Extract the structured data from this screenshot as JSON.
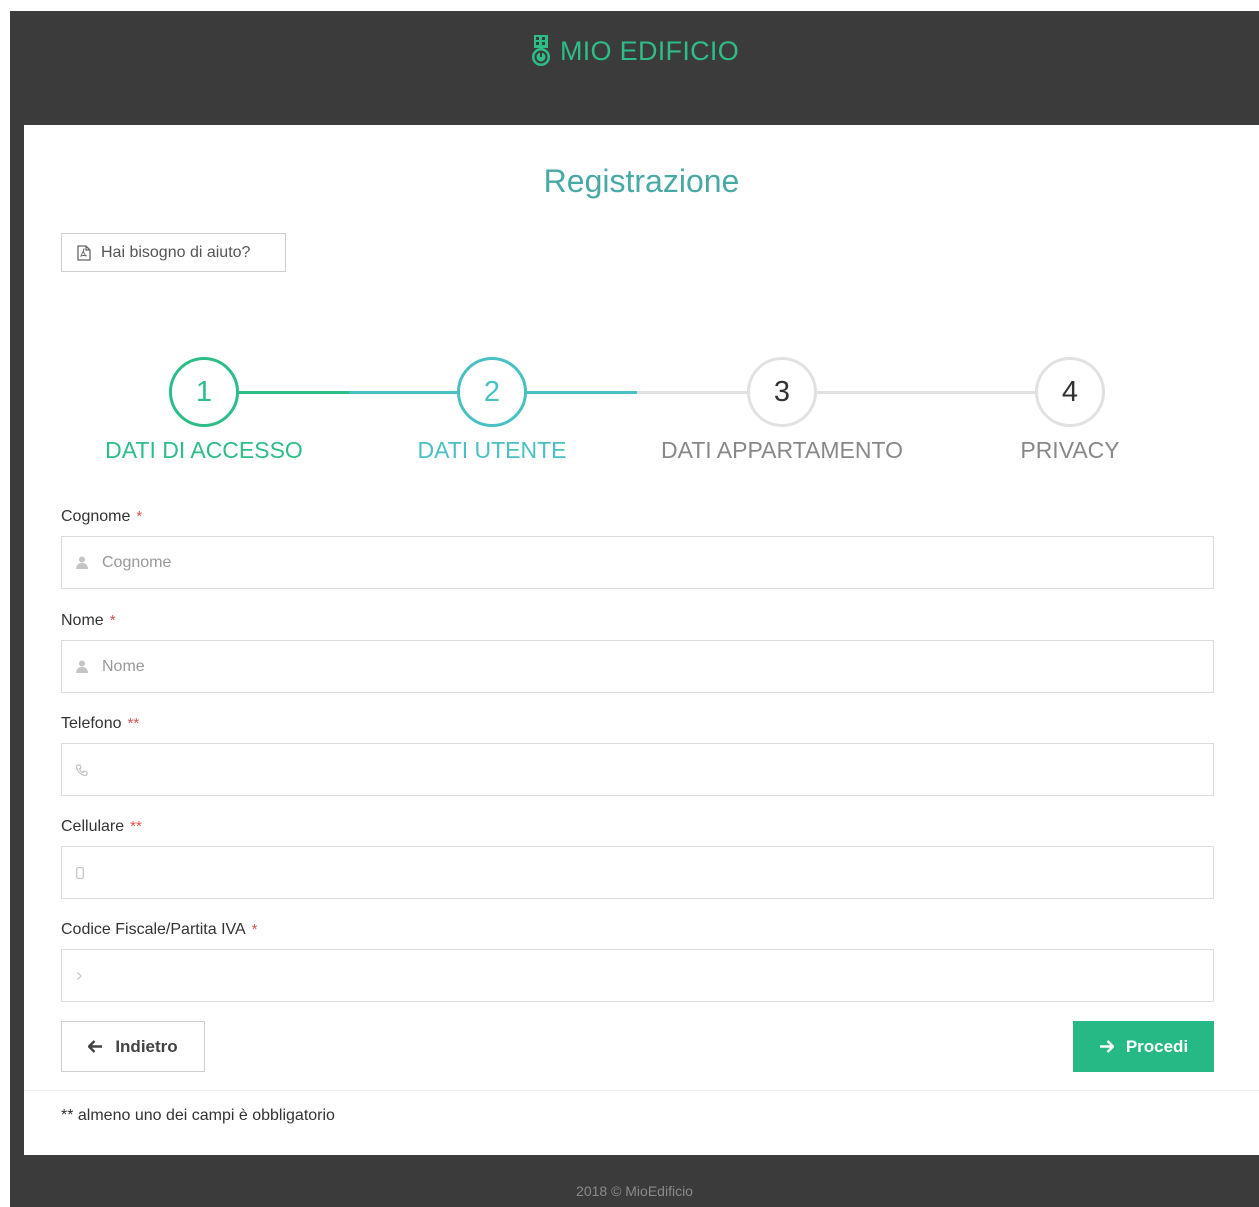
{
  "header": {
    "brand": "MIO EDIFICIO"
  },
  "page": {
    "title": "Registrazione",
    "help_button": "Hai bisogno di aiuto?"
  },
  "wizard": {
    "steps": [
      {
        "number": "1",
        "label": "DATI DI ACCESSO",
        "state": "done"
      },
      {
        "number": "2",
        "label": "DATI UTENTE",
        "state": "current"
      },
      {
        "number": "3",
        "label": "DATI APPARTAMENTO",
        "state": "pending"
      },
      {
        "number": "4",
        "label": "PRIVACY",
        "state": "pending"
      }
    ]
  },
  "form": {
    "fields": [
      {
        "label": "Cognome",
        "required": "*",
        "placeholder": "Cognome",
        "value": "",
        "icon": "user-icon"
      },
      {
        "label": "Nome",
        "required": "*",
        "placeholder": "Nome",
        "value": "",
        "icon": "user-icon"
      },
      {
        "label": "Telefono",
        "required": "**",
        "placeholder": "",
        "value": "",
        "icon": "phone-icon"
      },
      {
        "label": "Cellulare",
        "required": "**",
        "placeholder": "",
        "value": "",
        "icon": "mobile-icon"
      },
      {
        "label": "Codice Fiscale/Partita IVA",
        "required": "*",
        "placeholder": "",
        "value": "",
        "icon": "chevron-right-icon"
      }
    ],
    "back_button": "Indietro",
    "next_button": "Procedi"
  },
  "note": "** almeno uno dei campi è obbligatorio",
  "footer": {
    "text": "2018 © MioEdificio"
  },
  "colors": {
    "brand": "#2dbd87",
    "step_done": "#2dbd87",
    "step_current": "#49c0c4",
    "step_pending": "#e1e1e1",
    "title": "#49a9a5",
    "primary_button": "#26b885",
    "required": "#d9534f",
    "frame": "#3b3b3b"
  }
}
